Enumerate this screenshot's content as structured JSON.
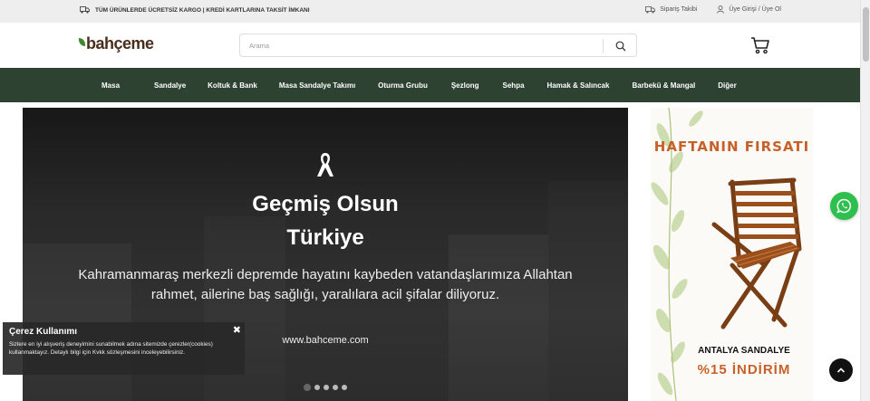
{
  "topbar": {
    "shipping_text": "TÜM ÜRÜNLERDE ÜCRETSİZ KARGO | KREDİ KARTLARINA TAKSİT İMKANI",
    "order_tracking": "Sipariş Takibi",
    "login": "Üye Girişi",
    "register": "/ Üye Ol"
  },
  "header": {
    "logo_text": "ahçeme",
    "search_placeholder": "Arama"
  },
  "nav": {
    "items": [
      "Masa",
      "Sandalye",
      "Koltuk & Bank",
      "Masa Sandalye Takımı",
      "Oturma Grubu",
      "Şezlong",
      "Sehpa",
      "Hamak & Salıncak",
      "Barbekü & Mangal",
      "Diğer"
    ]
  },
  "slider": {
    "headline_1": "Geçmiş Olsun",
    "headline_2": "Türkiye",
    "message": "Kahramanmaraş merkezli depremde hayatını kaybeden vatandaşlarımıza Allahtan rahmet, ailerine baş sağlığı, yaralılara acil şifalar diliyoruz.",
    "url": "www.bahceme.com",
    "slide_count": 5,
    "active_slide": 1
  },
  "promo": {
    "title": "HAFTANIN FIRSATI",
    "product_name": "ANTALYA SANDALYE",
    "discount": "%15 İNDİRİM"
  },
  "cookie": {
    "title": "Çerez Kullanımı",
    "close": "✖",
    "body": "Sizlere en iyi alışveriş deneyimini sunabilmek adına sitemizde çerezler(cookies) kullanmaktayız. Detaylı bilgi için Kvkk sözleşmesini inceleyebilirsiniz."
  },
  "colors": {
    "nav_bg": "#2e4232",
    "accent_orange": "#c8602a",
    "whatsapp_green": "#2fbf4e"
  }
}
